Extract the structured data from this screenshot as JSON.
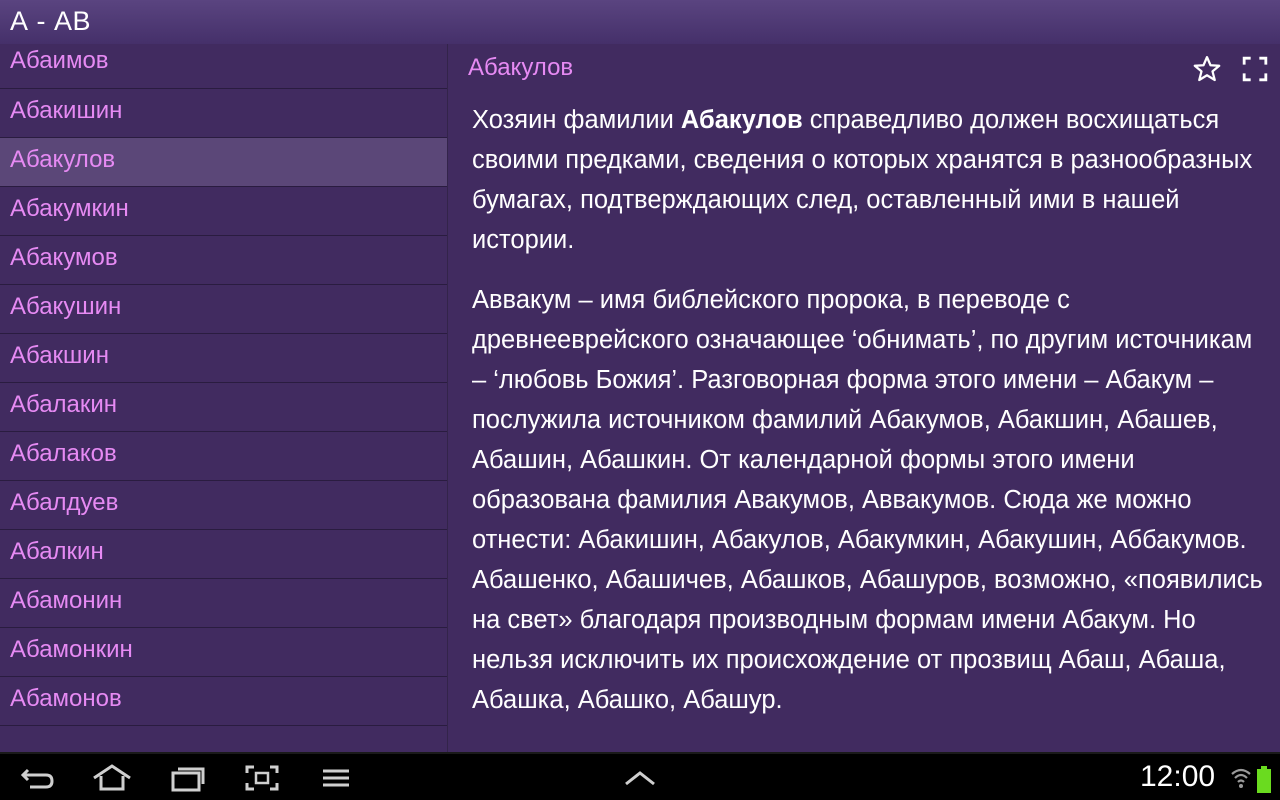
{
  "header": {
    "title": "А - АВ"
  },
  "list": {
    "items": [
      "Абаимов",
      "Абакишин",
      "Абакулов",
      "Абакумкин",
      "Абакумов",
      "Абакушин",
      "Абакшин",
      "Абалакин",
      "Абалаков",
      "Абалдуев",
      "Абалкин",
      "Абамонин",
      "Абамонкин",
      "Абамонов"
    ],
    "selected": "Абакулов"
  },
  "detail": {
    "title": "Абакулов",
    "p1_before": "Хозяин фамилии ",
    "p1_bold": "Абакулов",
    "p1_after": " справедливо должен восхищаться своими предками, сведения о которых хранятся в разнообразных бумагах, подтверждающих след, оставленный ими в нашей истории.",
    "p2": "Аввакум – имя библейского пророка, в переводе с древнееврейского означающее ‘обнимать’, по другим источникам – ‘любовь Божия’. Разговорная форма этого имени – Абакум – послужила источником фамилий Абакумов, Абакшин, Абашев, Абашин, Абашкин. От календарной формы этого имени образована фамилия Авакумов, Аввакумов. Сюда же можно отнести: Абакишин, Абакулов, Абакумкин, Абакушин, Аббакумов. Абашенко, Абашичев, Абашков, Абашуров, возможно, «появились на свет» благодаря производным формам имени Абакум. Но нельзя исключить их происхождение от прозвищ Абаш, Абаша, Абашка, Абашко, Абашур."
  },
  "system_bar": {
    "clock": "12:00",
    "icons": [
      "back-icon",
      "home-icon",
      "recent-apps-icon",
      "screenshot-icon",
      "menu-icon",
      "chevron-up-icon",
      "wifi-icon",
      "battery-icon"
    ]
  },
  "colors": {
    "background": "#412b60",
    "list_text": "#e68af3",
    "selected_row": "#5b4778",
    "body_text": "#ffffff"
  }
}
